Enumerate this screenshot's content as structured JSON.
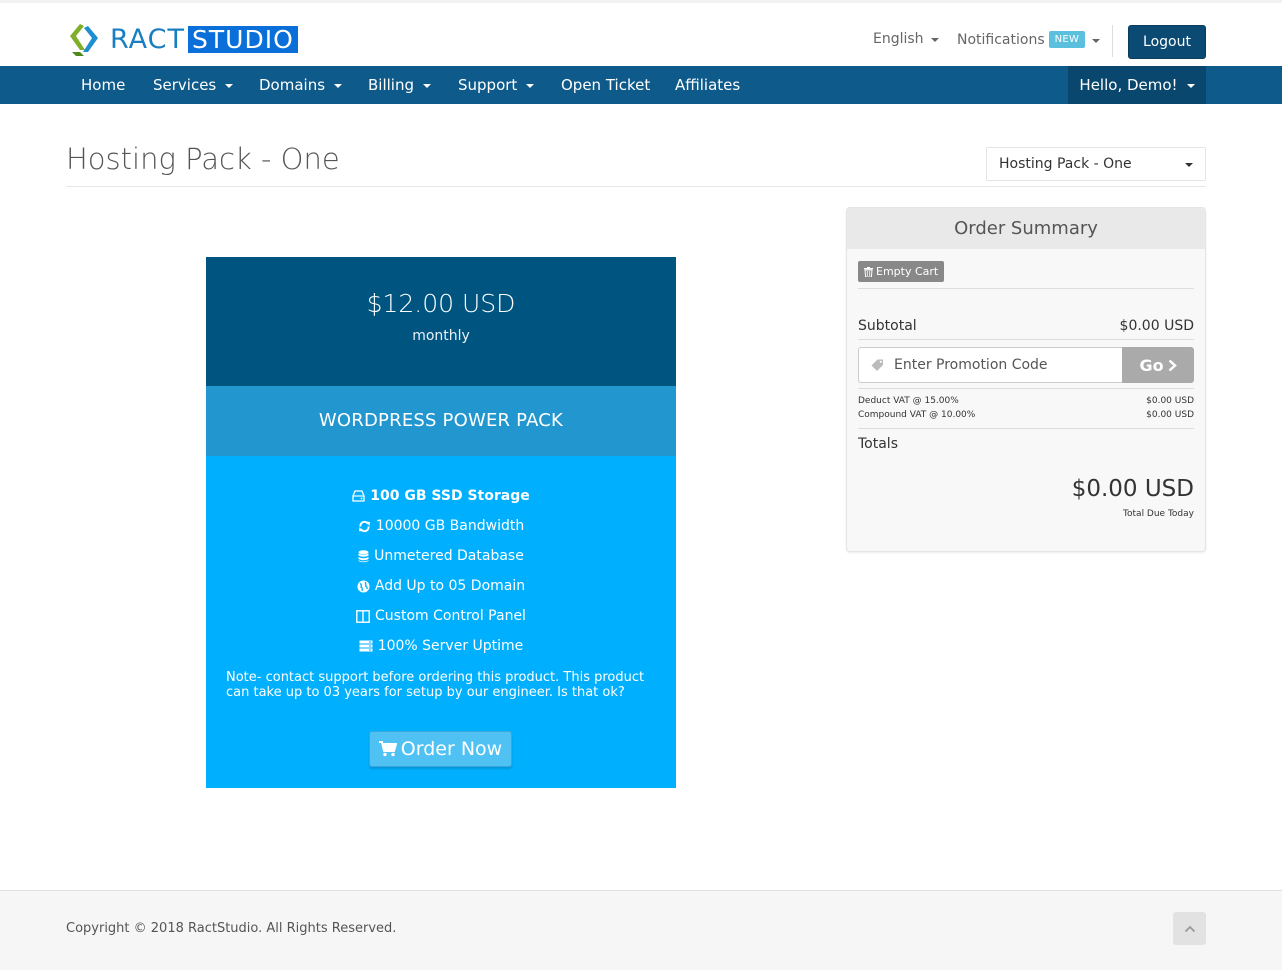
{
  "header": {
    "logo_text": "RACT",
    "logo_highlight": "STUDIO",
    "language": "English",
    "notifications_label": "Notifications",
    "notifications_badge": "NEW",
    "logout_label": "Logout"
  },
  "nav": {
    "items": [
      {
        "label": "Home",
        "dropdown": false
      },
      {
        "label": "Services",
        "dropdown": true
      },
      {
        "label": "Domains",
        "dropdown": true
      },
      {
        "label": "Billing",
        "dropdown": true
      },
      {
        "label": "Support",
        "dropdown": true
      },
      {
        "label": "Open Ticket",
        "dropdown": false
      },
      {
        "label": "Affiliates",
        "dropdown": false
      }
    ],
    "user_greeting": "Hello, Demo!"
  },
  "page": {
    "title": "Hosting Pack - One",
    "product_select_value": "Hosting Pack - One"
  },
  "product": {
    "price": "$12.00 USD",
    "cycle": "monthly",
    "name": "WORDPRESS POWER PACK",
    "features": [
      {
        "icon": "hdd-icon",
        "text": "100 GB SSD Storage",
        "bold": true
      },
      {
        "icon": "refresh-icon",
        "text": "10000 GB Bandwidth",
        "bold": false
      },
      {
        "icon": "database-icon",
        "text": "Unmetered Database",
        "bold": false
      },
      {
        "icon": "globe-icon",
        "text": "Add Up to 05 Domain",
        "bold": false
      },
      {
        "icon": "columns-icon",
        "text": "Custom Control Panel",
        "bold": false
      },
      {
        "icon": "server-icon",
        "text": "100% Server Uptime",
        "bold": false
      }
    ],
    "note": "Note- contact support before ordering this product. This product can take up to 03 years for setup by our engineer. Is that ok?",
    "order_label": "Order Now"
  },
  "summary": {
    "title": "Order Summary",
    "empty_cart_label": "Empty Cart",
    "subtotal_label": "Subtotal",
    "subtotal_value": "$0.00 USD",
    "promo_placeholder": "Enter Promotion Code",
    "promo_button": "Go",
    "taxes": [
      {
        "label": "Deduct VAT @ 15.00%",
        "value": "$0.00 USD"
      },
      {
        "label": "Compound VAT @ 10.00%",
        "value": "$0.00 USD"
      }
    ],
    "totals_label": "Totals",
    "total_value": "$0.00 USD",
    "total_caption": "Total Due Today"
  },
  "footer": {
    "copyright": "Copyright © 2018 RactStudio. All Rights Reserved."
  },
  "colors": {
    "nav_bg": "#0e5a8a",
    "price_bg": "#005580",
    "name_bg": "#2196cf",
    "body_bg": "#00b0ff",
    "logout_bg": "#0b4a72"
  }
}
